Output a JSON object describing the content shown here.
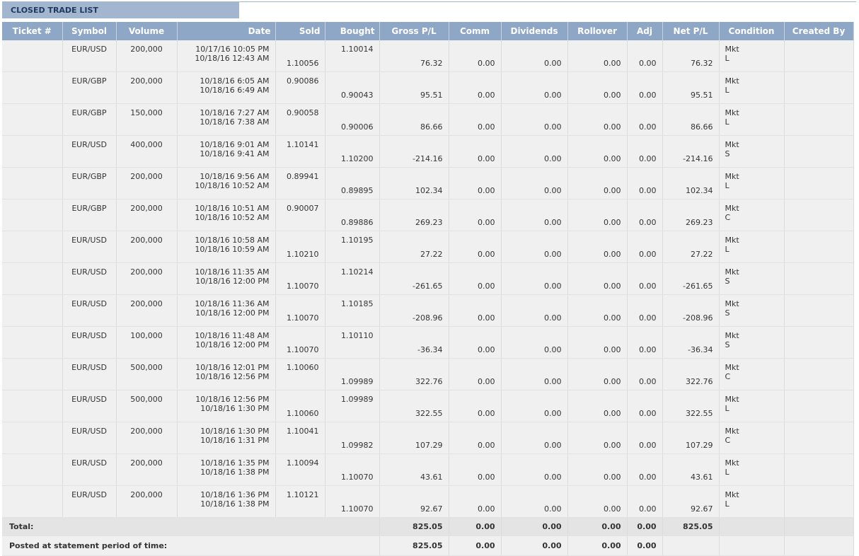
{
  "section": {
    "title": "CLOSED TRADE LIST"
  },
  "columns": [
    "Ticket #",
    "Symbol",
    "Volume",
    "Date",
    "Sold",
    "Bought",
    "Gross P/L",
    "Comm",
    "Dividends",
    "Rollover",
    "Adj",
    "Net P/L",
    "Condition",
    "Created By"
  ],
  "rows": [
    {
      "ticket": "",
      "symbol": "EUR/USD",
      "volume": "200,000",
      "date_open": "10/17/16 10:05 PM",
      "date_close": "10/18/16 12:43 AM",
      "sold": "1.10056",
      "sold_pos": "bottom",
      "bought": "1.10014",
      "bought_pos": "top",
      "gross": "76.32",
      "comm": "0.00",
      "div": "0.00",
      "roll": "0.00",
      "adj": "0.00",
      "net": "76.32",
      "cond_type": "Mkt",
      "cond_side": "L",
      "created_by": ""
    },
    {
      "ticket": "",
      "symbol": "EUR/GBP",
      "volume": "200,000",
      "date_open": "10/18/16 6:05 AM",
      "date_close": "10/18/16 6:49 AM",
      "sold": "0.90086",
      "sold_pos": "top",
      "bought": "0.90043",
      "bought_pos": "bottom",
      "gross": "95.51",
      "comm": "0.00",
      "div": "0.00",
      "roll": "0.00",
      "adj": "0.00",
      "net": "95.51",
      "cond_type": "Mkt",
      "cond_side": "L",
      "created_by": ""
    },
    {
      "ticket": "",
      "symbol": "EUR/GBP",
      "volume": "150,000",
      "date_open": "10/18/16 7:27 AM",
      "date_close": "10/18/16 7:38 AM",
      "sold": "0.90058",
      "sold_pos": "top",
      "bought": "0.90006",
      "bought_pos": "bottom",
      "gross": "86.66",
      "comm": "0.00",
      "div": "0.00",
      "roll": "0.00",
      "adj": "0.00",
      "net": "86.66",
      "cond_type": "Mkt",
      "cond_side": "L",
      "created_by": ""
    },
    {
      "ticket": "",
      "symbol": "EUR/USD",
      "volume": "400,000",
      "date_open": "10/18/16 9:01 AM",
      "date_close": "10/18/16 9:41 AM",
      "sold": "1.10141",
      "sold_pos": "top",
      "bought": "1.10200",
      "bought_pos": "bottom",
      "gross": "-214.16",
      "comm": "0.00",
      "div": "0.00",
      "roll": "0.00",
      "adj": "0.00",
      "net": "-214.16",
      "cond_type": "Mkt",
      "cond_side": "S",
      "created_by": ""
    },
    {
      "ticket": "",
      "symbol": "EUR/GBP",
      "volume": "200,000",
      "date_open": "10/18/16 9:56 AM",
      "date_close": "10/18/16 10:52 AM",
      "sold": "0.89941",
      "sold_pos": "top",
      "bought": "0.89895",
      "bought_pos": "bottom",
      "gross": "102.34",
      "comm": "0.00",
      "div": "0.00",
      "roll": "0.00",
      "adj": "0.00",
      "net": "102.34",
      "cond_type": "Mkt",
      "cond_side": "L",
      "created_by": ""
    },
    {
      "ticket": "",
      "symbol": "EUR/GBP",
      "volume": "200,000",
      "date_open": "10/18/16 10:51 AM",
      "date_close": "10/18/16 10:52 AM",
      "sold": "0.90007",
      "sold_pos": "top",
      "bought": "0.89886",
      "bought_pos": "bottom",
      "gross": "269.23",
      "comm": "0.00",
      "div": "0.00",
      "roll": "0.00",
      "adj": "0.00",
      "net": "269.23",
      "cond_type": "Mkt",
      "cond_side": "C",
      "created_by": ""
    },
    {
      "ticket": "",
      "symbol": "EUR/USD",
      "volume": "200,000",
      "date_open": "10/18/16 10:58 AM",
      "date_close": "10/18/16 10:59 AM",
      "sold": "1.10210",
      "sold_pos": "bottom",
      "bought": "1.10195",
      "bought_pos": "top",
      "gross": "27.22",
      "comm": "0.00",
      "div": "0.00",
      "roll": "0.00",
      "adj": "0.00",
      "net": "27.22",
      "cond_type": "Mkt",
      "cond_side": "L",
      "created_by": ""
    },
    {
      "ticket": "",
      "symbol": "EUR/USD",
      "volume": "200,000",
      "date_open": "10/18/16 11:35 AM",
      "date_close": "10/18/16 12:00 PM",
      "sold": "1.10070",
      "sold_pos": "bottom",
      "bought": "1.10214",
      "bought_pos": "top",
      "gross": "-261.65",
      "comm": "0.00",
      "div": "0.00",
      "roll": "0.00",
      "adj": "0.00",
      "net": "-261.65",
      "cond_type": "Mkt",
      "cond_side": "S",
      "created_by": ""
    },
    {
      "ticket": "",
      "symbol": "EUR/USD",
      "volume": "200,000",
      "date_open": "10/18/16 11:36 AM",
      "date_close": "10/18/16 12:00 PM",
      "sold": "1.10070",
      "sold_pos": "bottom",
      "bought": "1.10185",
      "bought_pos": "top",
      "gross": "-208.96",
      "comm": "0.00",
      "div": "0.00",
      "roll": "0.00",
      "adj": "0.00",
      "net": "-208.96",
      "cond_type": "Mkt",
      "cond_side": "S",
      "created_by": ""
    },
    {
      "ticket": "",
      "symbol": "EUR/USD",
      "volume": "100,000",
      "date_open": "10/18/16 11:48 AM",
      "date_close": "10/18/16 12:00 PM",
      "sold": "1.10070",
      "sold_pos": "bottom",
      "bought": "1.10110",
      "bought_pos": "top",
      "gross": "-36.34",
      "comm": "0.00",
      "div": "0.00",
      "roll": "0.00",
      "adj": "0.00",
      "net": "-36.34",
      "cond_type": "Mkt",
      "cond_side": "S",
      "created_by": ""
    },
    {
      "ticket": "",
      "symbol": "EUR/USD",
      "volume": "500,000",
      "date_open": "10/18/16 12:01 PM",
      "date_close": "10/18/16 12:56 PM",
      "sold": "1.10060",
      "sold_pos": "top",
      "bought": "1.09989",
      "bought_pos": "bottom",
      "gross": "322.76",
      "comm": "0.00",
      "div": "0.00",
      "roll": "0.00",
      "adj": "0.00",
      "net": "322.76",
      "cond_type": "Mkt",
      "cond_side": "C",
      "created_by": ""
    },
    {
      "ticket": "",
      "symbol": "EUR/USD",
      "volume": "500,000",
      "date_open": "10/18/16 12:56 PM",
      "date_close": "10/18/16 1:30 PM",
      "sold": "1.10060",
      "sold_pos": "bottom",
      "bought": "1.09989",
      "bought_pos": "top",
      "gross": "322.55",
      "comm": "0.00",
      "div": "0.00",
      "roll": "0.00",
      "adj": "0.00",
      "net": "322.55",
      "cond_type": "Mkt",
      "cond_side": "L",
      "created_by": ""
    },
    {
      "ticket": "",
      "symbol": "EUR/USD",
      "volume": "200,000",
      "date_open": "10/18/16 1:30 PM",
      "date_close": "10/18/16 1:31 PM",
      "sold": "1.10041",
      "sold_pos": "top",
      "bought": "1.09982",
      "bought_pos": "bottom",
      "gross": "107.29",
      "comm": "0.00",
      "div": "0.00",
      "roll": "0.00",
      "adj": "0.00",
      "net": "107.29",
      "cond_type": "Mkt",
      "cond_side": "C",
      "created_by": ""
    },
    {
      "ticket": "",
      "symbol": "EUR/USD",
      "volume": "200,000",
      "date_open": "10/18/16 1:35 PM",
      "date_close": "10/18/16 1:38 PM",
      "sold": "1.10094",
      "sold_pos": "top",
      "bought": "1.10070",
      "bought_pos": "bottom",
      "gross": "43.61",
      "comm": "0.00",
      "div": "0.00",
      "roll": "0.00",
      "adj": "0.00",
      "net": "43.61",
      "cond_type": "Mkt",
      "cond_side": "L",
      "created_by": ""
    },
    {
      "ticket": "",
      "symbol": "EUR/USD",
      "volume": "200,000",
      "date_open": "10/18/16 1:36 PM",
      "date_close": "10/18/16 1:38 PM",
      "sold": "1.10121",
      "sold_pos": "top",
      "bought": "1.10070",
      "bought_pos": "bottom",
      "gross": "92.67",
      "comm": "0.00",
      "div": "0.00",
      "roll": "0.00",
      "adj": "0.00",
      "net": "92.67",
      "cond_type": "Mkt",
      "cond_side": "L",
      "created_by": ""
    }
  ],
  "total": {
    "label": "Total:",
    "gross": "825.05",
    "comm": "0.00",
    "div": "0.00",
    "roll": "0.00",
    "adj": "0.00",
    "net": "825.05"
  },
  "posted": {
    "label": "Posted at statement period of time:",
    "gross": "825.05",
    "comm": "0.00",
    "div": "0.00",
    "roll": "0.00",
    "adj": "0.00"
  }
}
